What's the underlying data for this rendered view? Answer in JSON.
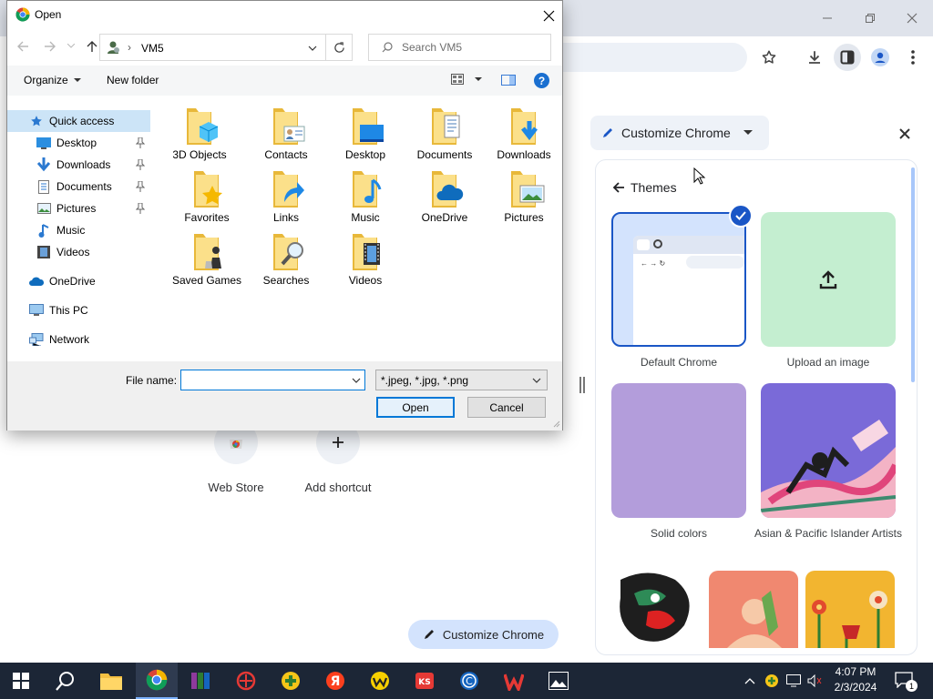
{
  "browser": {
    "window_controls": [
      "minimize",
      "restore",
      "close"
    ],
    "toolbar_icons": [
      "star-icon",
      "download-icon",
      "side-panel-icon",
      "profile-icon",
      "menu-icon"
    ]
  },
  "ntp": {
    "shortcuts": [
      {
        "label": "Web Store",
        "icon": "chrome-web-store-icon"
      },
      {
        "label": "Add shortcut",
        "icon": "plus-icon"
      }
    ],
    "customize_button": "Customize Chrome"
  },
  "side_panel": {
    "title": "Customize Chrome",
    "back_label": "Themes",
    "themes": [
      {
        "label": "Default Chrome",
        "selected": true
      },
      {
        "label": "Upload an image",
        "selected": false
      },
      {
        "label": "Solid colors",
        "selected": false
      },
      {
        "label": "Asian & Pacific Islander Artists",
        "selected": false
      }
    ],
    "colors": {
      "accent": "#1a73e8",
      "selected_bg": "#d3e3fd",
      "upload_bg": "#c4eed0",
      "solid_bg": "#b39ddb"
    }
  },
  "dialog": {
    "title": "Open",
    "path_segment": "VM5",
    "search_placeholder": "Search VM5",
    "commands": {
      "organize": "Organize",
      "new_folder": "New folder"
    },
    "nav": [
      {
        "label": "Quick access",
        "icon": "star-icon",
        "pinned": false,
        "selected": true
      },
      {
        "label": "Desktop",
        "icon": "desktop-icon",
        "pinned": true
      },
      {
        "label": "Downloads",
        "icon": "download-arrow-icon",
        "pinned": true
      },
      {
        "label": "Documents",
        "icon": "document-icon",
        "pinned": true
      },
      {
        "label": "Pictures",
        "icon": "picture-icon",
        "pinned": true
      },
      {
        "label": "Music",
        "icon": "music-note-icon",
        "pinned": false
      },
      {
        "label": "Videos",
        "icon": "film-icon",
        "pinned": false
      },
      {
        "label": "OneDrive",
        "icon": "cloud-icon",
        "pinned": false
      },
      {
        "label": "This PC",
        "icon": "monitor-icon",
        "pinned": false
      },
      {
        "label": "Network",
        "icon": "network-icon",
        "pinned": false
      }
    ],
    "files": [
      {
        "label": "3D Objects",
        "overlay": "cube"
      },
      {
        "label": "Contacts",
        "overlay": "contact-card"
      },
      {
        "label": "Desktop",
        "overlay": "monitor"
      },
      {
        "label": "Documents",
        "overlay": "document"
      },
      {
        "label": "Downloads",
        "overlay": "download-arrow"
      },
      {
        "label": "Favorites",
        "overlay": "star"
      },
      {
        "label": "Links",
        "overlay": "link-arrow"
      },
      {
        "label": "Music",
        "overlay": "music-note"
      },
      {
        "label": "OneDrive",
        "overlay": "cloud"
      },
      {
        "label": "Pictures",
        "overlay": "picture"
      },
      {
        "label": "Saved Games",
        "overlay": "chess"
      },
      {
        "label": "Searches",
        "overlay": "magnifier"
      },
      {
        "label": "Videos",
        "overlay": "film"
      }
    ],
    "file_name_label": "File name:",
    "file_name_value": "",
    "file_type": "*.jpeg, *.jpg, *.png",
    "open_button": "Open",
    "cancel_button": "Cancel"
  },
  "taskbar": {
    "apps": [
      "start-icon",
      "search-icon",
      "file-explorer-icon",
      "chrome-icon",
      "winrar-icon",
      "kaspersky-icon",
      "green-plus-icon",
      "yandex-icon",
      "yellow-w-icon",
      "ks-icon",
      "ccleaner-icon",
      "wps-icon",
      "photos-icon"
    ],
    "time": "4:07 PM",
    "date": "2/3/2024",
    "notification_count": "1"
  }
}
